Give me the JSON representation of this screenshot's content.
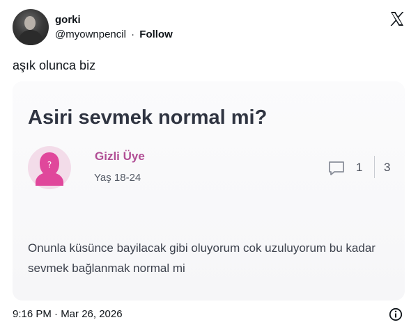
{
  "post": {
    "display_name": "gorki",
    "handle": "@myownpencil",
    "separator": "·",
    "follow_label": "Follow",
    "text": "aşık olunca biz",
    "timestamp": "9:16 PM · Mar 26, 2026"
  },
  "embedded_card": {
    "question_title": "Asiri sevmek normal mi?",
    "author_name": "Gizli Üye",
    "author_age": "Yaş 18-24",
    "comment_count": "1",
    "like_count": "3",
    "body": "Onunla küsünce bayilacak gibi oluyorum cok uzuluyorum bu kadar sevmek bağlanmak normal mi"
  },
  "icons": {
    "platform_logo": "x-logo-icon",
    "anonymous_avatar": "anonymous-user-icon",
    "comment": "comment-bubble-icon",
    "info": "info-icon"
  },
  "colors": {
    "author_name": "#b14e95",
    "anon_avatar_bg": "#f3dce9",
    "anon_avatar_fg": "#e0479b"
  }
}
